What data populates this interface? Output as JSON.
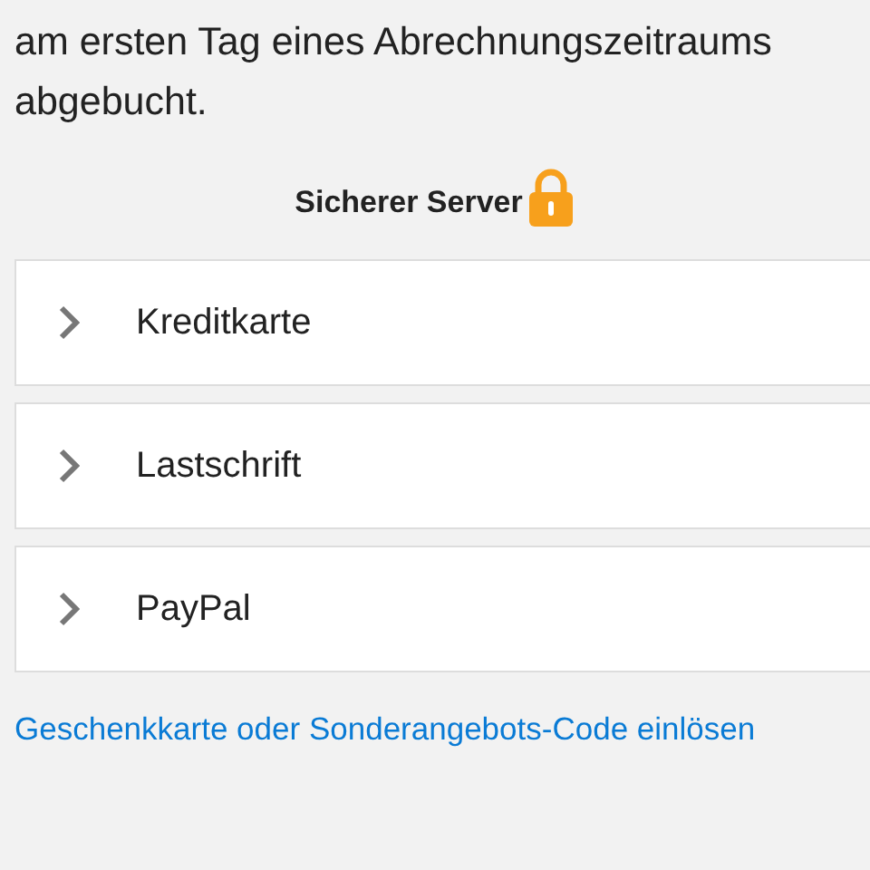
{
  "intro": {
    "lines": [
      "am ersten Tag eines Abrechnungszeitraums",
      "abgebucht."
    ]
  },
  "secure": {
    "label": "Sicherer Server"
  },
  "payment_methods": [
    {
      "label": "Kreditkarte",
      "expanded": false
    },
    {
      "label": "Lastschrift",
      "expanded": false
    },
    {
      "label": "PayPal",
      "expanded": false
    }
  ],
  "link": "Geschenkkarte oder Sonderangebots-Code einlösen"
}
